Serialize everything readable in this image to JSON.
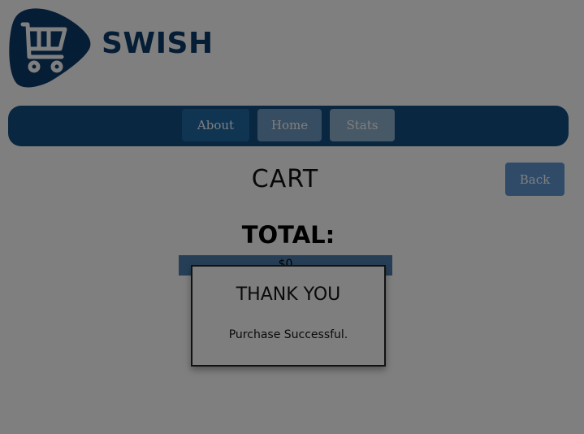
{
  "brand": {
    "name": "SWISH",
    "logo_icon": "shopping-cart-icon",
    "color": "#0a3a6a"
  },
  "nav": {
    "items": [
      {
        "label": "About"
      },
      {
        "label": "Home"
      },
      {
        "label": "Stats"
      }
    ]
  },
  "cart": {
    "title": "CART",
    "back_label": "Back",
    "total_label": "TOTAL:",
    "total_value": "$0"
  },
  "modal": {
    "title": "THANK YOU",
    "message": "Purchase Successful."
  },
  "colors": {
    "nav_bar": "#124f80",
    "accent": "#5e97d1"
  }
}
